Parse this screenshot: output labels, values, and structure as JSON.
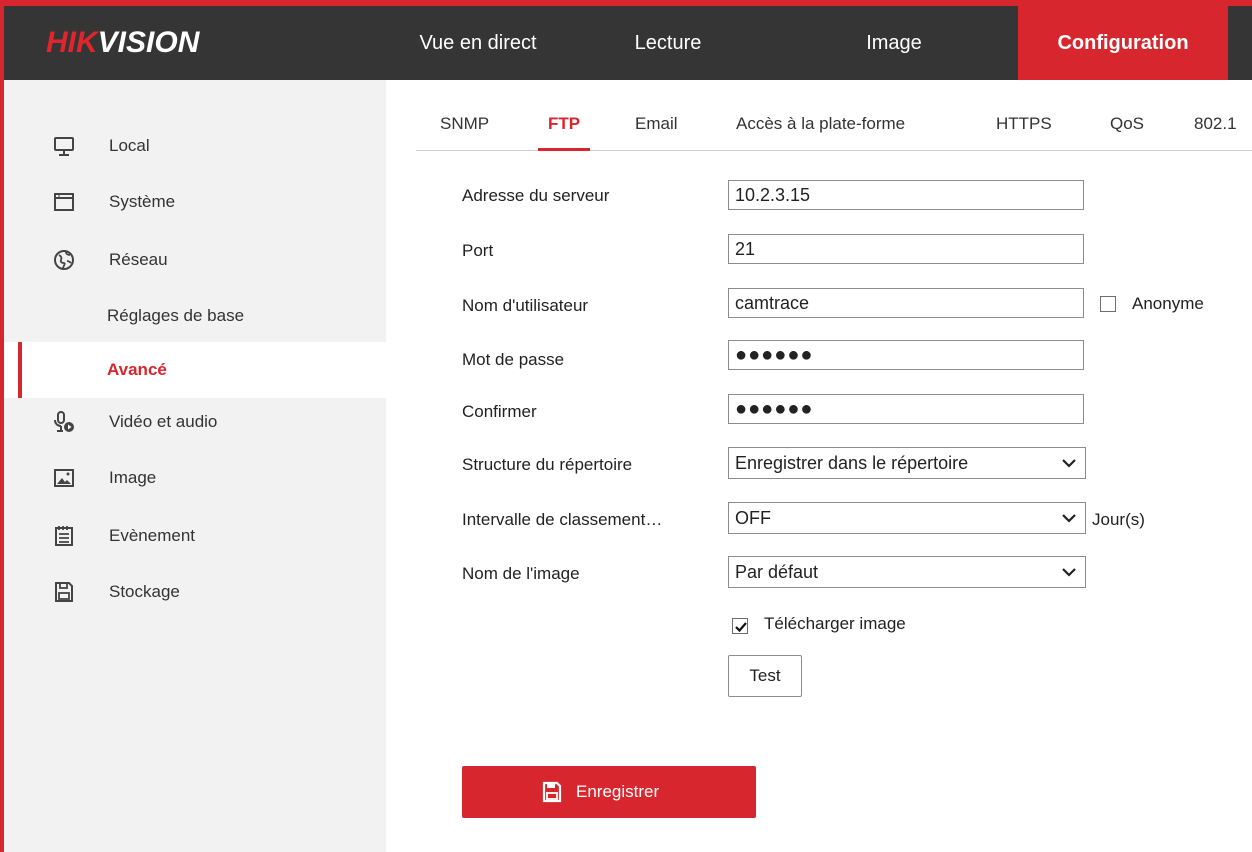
{
  "brand": {
    "part1": "HIK",
    "part2": "VISION"
  },
  "nav": {
    "live": "Vue en direct",
    "playback": "Lecture",
    "image": "Image",
    "config": "Configuration"
  },
  "sidebar": {
    "local": "Local",
    "system": "Système",
    "network": "Réseau",
    "basic": "Réglages de base",
    "advanced": "Avancé",
    "video_audio": "Vidéo et audio",
    "image": "Image",
    "event": "Evènement",
    "storage": "Stockage"
  },
  "tabs": {
    "snmp": "SNMP",
    "ftp": "FTP",
    "email": "Email",
    "platform": "Accès à la plate-forme",
    "https": "HTTPS",
    "qos": "QoS",
    "dot1x": "802.1"
  },
  "form": {
    "server_label": "Adresse du serveur",
    "server_value": "10.2.3.15",
    "port_label": "Port",
    "port_value": "21",
    "user_label": "Nom d'utilisateur",
    "user_value": "camtrace",
    "anonymous_label": "Anonyme",
    "anonymous_checked": false,
    "password_label": "Mot de passe",
    "password_value": "●●●●●●",
    "confirm_label": "Confirmer",
    "confirm_value": "●●●●●●",
    "dir_structure_label": "Structure du répertoire",
    "dir_structure_value": "Enregistrer dans le répertoire",
    "archive_interval_label": "Intervalle de classement…",
    "archive_interval_value": "OFF",
    "archive_interval_unit": "Jour(s)",
    "picture_name_label": "Nom de l'image",
    "picture_name_value": "Par défaut",
    "upload_label": "Télécharger image",
    "upload_checked": true,
    "test_label": "Test",
    "save_label": "Enregistrer"
  },
  "colors": {
    "accent": "#d7262e",
    "header_bg": "#353535",
    "sidebar_bg": "#f2f2f2"
  }
}
